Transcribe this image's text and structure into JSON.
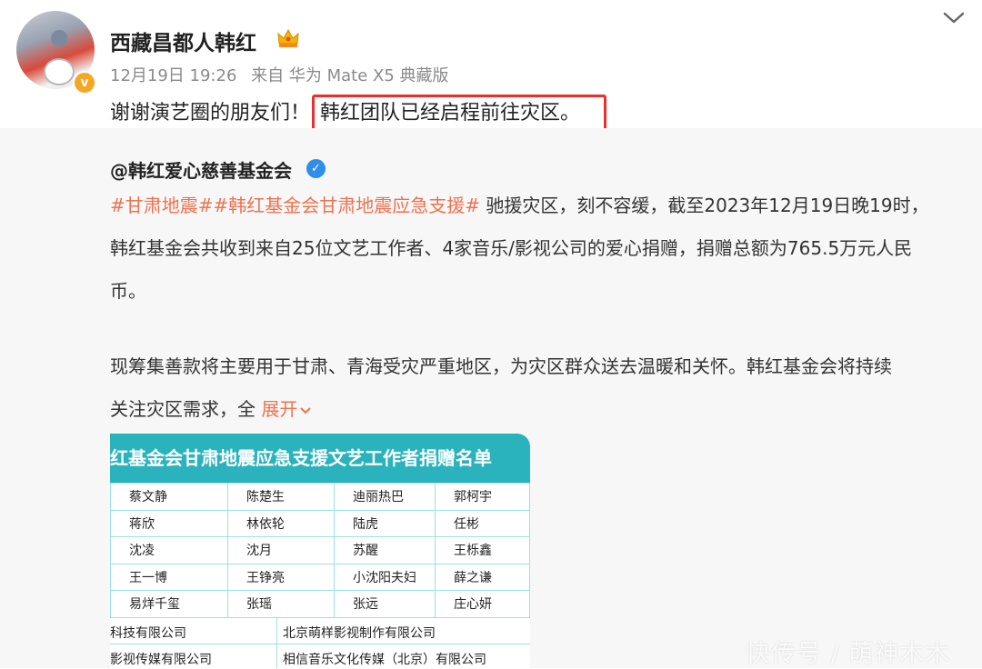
{
  "post": {
    "username": "西藏昌都人韩红",
    "time": "12月19日 19:26",
    "source": "来自 华为 Mate X5 典藏版",
    "text_plain": "谢谢演艺圈的朋友们！",
    "text_highlight": "韩红团队已经启程前往灾区。"
  },
  "repost": {
    "author": "@韩红爱心慈善基金会",
    "tags": "#甘肃地震##韩红基金会甘肃地震应急支援#",
    "para1_line1_rest": " 驰援灾区，刻不容缓，截至2023年12月19日晚19时，",
    "para1_line2": "韩红基金会共收到来自25位文艺工作者、4家音乐/影视公司的爱心捐赠，捐赠总额为765.5万元人民",
    "para1_line3": "币。",
    "para2_line1": "现筹集善款将主要用于甘肃、青海受灾严重地区，为灾区群众送去温暖和关怀。韩红基金会将持续",
    "para2_line2": "关注灾区需求，全",
    "expand_label": "展开"
  },
  "donor_table": {
    "title": "韩红基金会甘肃地震应急支援文艺工作者捐赠名单",
    "rows": [
      [
        "蔡文静",
        "陈楚生",
        "迪丽热巴",
        "郭柯宇"
      ],
      [
        "蒋欣",
        "林依轮",
        "陆虎",
        "任彬"
      ],
      [
        "沈凌",
        "沈月",
        "苏醒",
        "王栎鑫"
      ],
      [
        "王一博",
        "王铮亮",
        "小沈阳夫妇",
        "薛之谦"
      ],
      [
        "易烊千玺",
        "张瑶",
        "张远",
        "庄心妍"
      ]
    ],
    "companies": [
      [
        "科技有限公司",
        "北京萌样影视制作有限公司"
      ],
      [
        "影视传媒有限公司",
        "相信音乐文化传媒（北京）有限公司"
      ]
    ]
  },
  "watermark": "快传号 / 萌神木木",
  "colors": {
    "highlight_border": "#e8312f",
    "tag": "#eb7350",
    "table_header": "#2ab3bc",
    "verified": "#2e8ee8"
  }
}
